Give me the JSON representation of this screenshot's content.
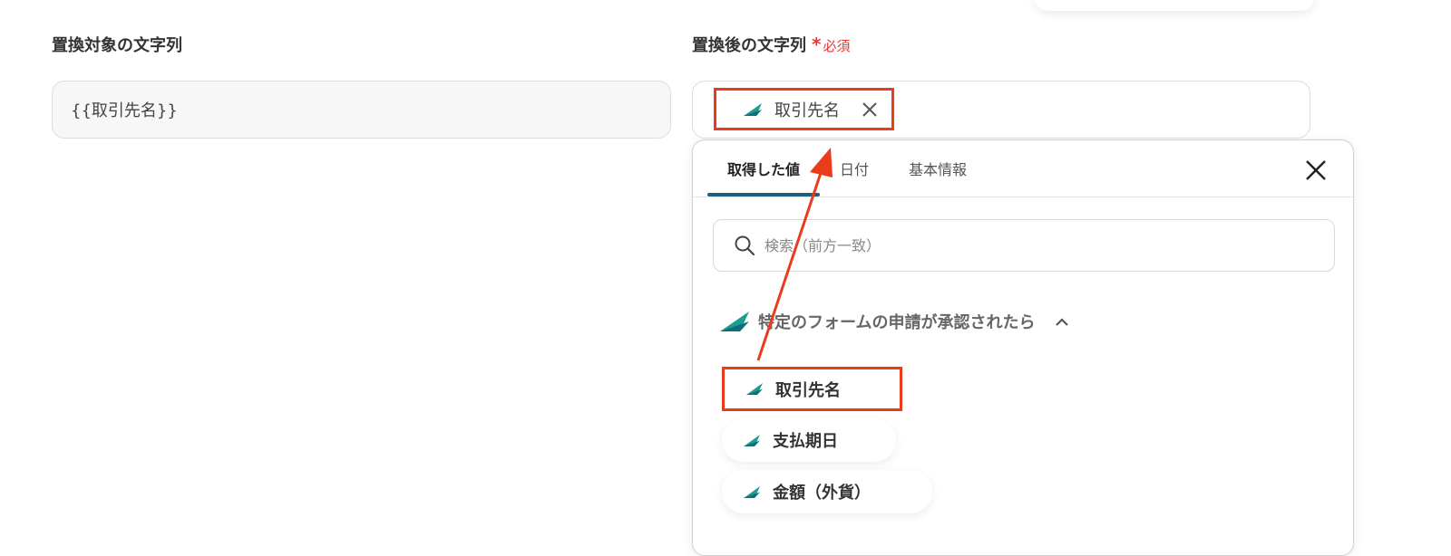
{
  "left_field": {
    "label": "置換対象の文字列",
    "value": "{{取引先名}}"
  },
  "right_field": {
    "label": "置換後の文字列",
    "required_mark": "*",
    "required_text": "必須",
    "chip_label": "取引先名"
  },
  "dropdown": {
    "tabs": [
      {
        "label": "取得した値",
        "active": true
      },
      {
        "label": "日付",
        "active": false
      },
      {
        "label": "基本情報",
        "active": false
      }
    ],
    "search_placeholder": "検索（前方一致）",
    "group_title": "特定のフォームの申請が承認されたら",
    "items": [
      {
        "label": "取引先名",
        "highlighted": true
      },
      {
        "label": "支払期日",
        "highlighted": false
      },
      {
        "label": "金額（外貨）",
        "highlighted": false
      }
    ]
  },
  "colors": {
    "accent_red": "#ea3b1b",
    "required_red": "#e53935",
    "tab_underline": "#1f5f7a",
    "icon_teal": "#1a9e8f"
  },
  "icons": {
    "app": "app-logo-icon",
    "close": "close-icon",
    "search": "search-icon",
    "chevron": "chevron-up-icon"
  }
}
